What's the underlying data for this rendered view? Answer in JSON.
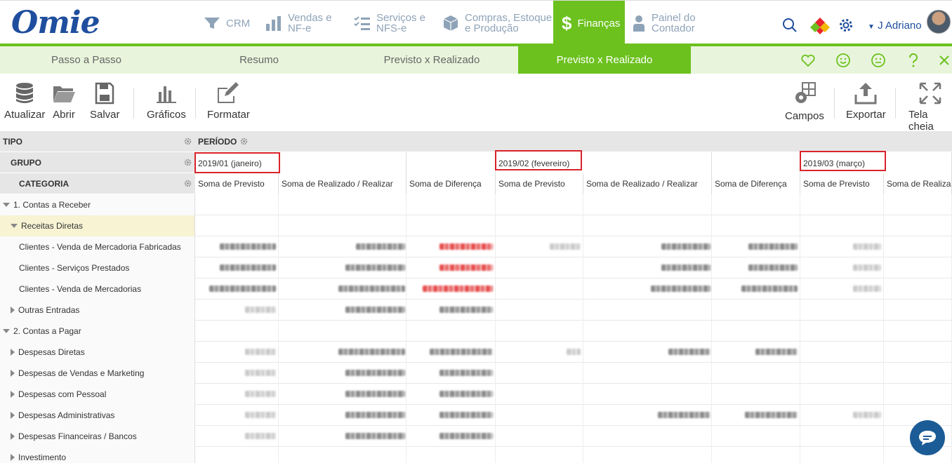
{
  "app": {
    "logo": "Omie",
    "user": "J Adriano"
  },
  "nav": [
    {
      "l1": "CRM",
      "l2": ""
    },
    {
      "l1": "Vendas e",
      "l2": "NF-e"
    },
    {
      "l1": "Serviços e",
      "l2": "NFS-e"
    },
    {
      "l1": "Compras, Estoque",
      "l2": "e Produção"
    },
    {
      "l1": "Finanças",
      "l2": ""
    },
    {
      "l1": "Painel do",
      "l2": "Contador"
    }
  ],
  "tabs": [
    "Passo a Passo",
    "Resumo",
    "Previsto x Realizado",
    "Previsto x Realizado"
  ],
  "toolbar": {
    "left": [
      "Atualizar",
      "Abrir",
      "Salvar",
      "Gráficos",
      "Formatar"
    ],
    "right": [
      "Campos",
      "Exportar",
      "Tela cheia"
    ]
  },
  "pivot": {
    "hdr_tipo": "TIPO",
    "hdr_grupo": "GRUPO",
    "hdr_categoria": "CATEGORIA",
    "hdr_periodo": "PERÍODO",
    "periods": [
      "2019/01 (janeiro)",
      "2019/02 (fevereiro)",
      "2019/03 (março)"
    ],
    "measures": [
      "Soma de Previsto",
      "Soma de Realizado / Realizar",
      "Soma de Diferença",
      "Soma de Previsto",
      "Soma de Realizado / Realizar",
      "Soma de Diferença",
      "Soma de Previsto",
      "Soma de Realizado / Realizar"
    ],
    "rows": [
      {
        "label": "1. Contas a Receber"
      },
      {
        "label": "Receitas Diretas"
      },
      {
        "label": "Clientes - Venda de Mercadoria Fabricadas"
      },
      {
        "label": "Clientes - Serviços Prestados"
      },
      {
        "label": "Clientes - Venda de Mercadorias"
      },
      {
        "label": "Outras Entradas"
      },
      {
        "label": "2. Contas a Pagar"
      },
      {
        "label": "Despesas Diretas"
      },
      {
        "label": "Despesas de Vendas e Marketing"
      },
      {
        "label": "Despesas com Pessoal"
      },
      {
        "label": "Despesas Administrativas"
      },
      {
        "label": "Despesas Financeiras / Bancos"
      },
      {
        "label": "Investimento"
      }
    ]
  },
  "colors": {
    "accent": "#6cc11e",
    "brand": "#1f4e9e",
    "highlight_box": "#d9232a"
  }
}
